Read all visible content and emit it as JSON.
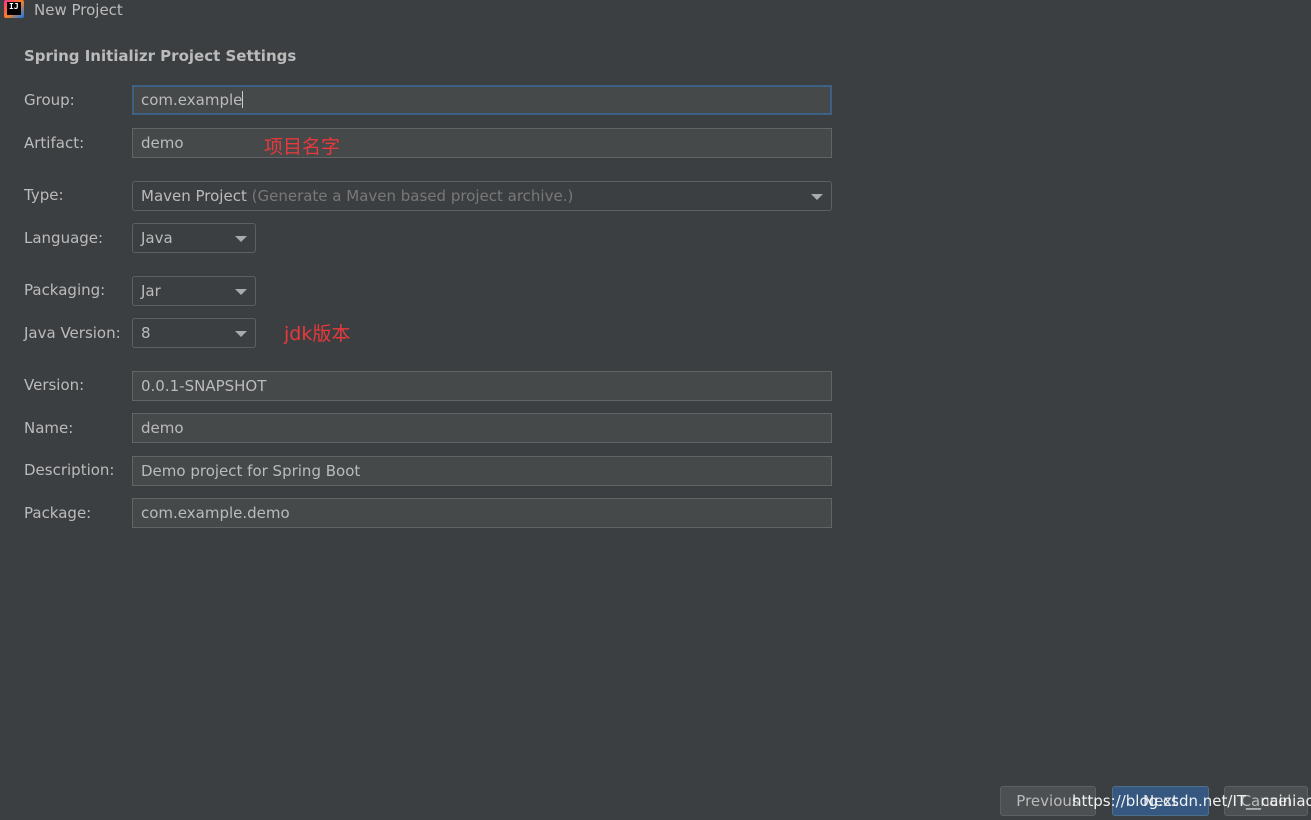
{
  "window": {
    "title": "New Project"
  },
  "section_title": "Spring Initializr Project Settings",
  "form": {
    "group": {
      "label": "Group:",
      "value": "com.example"
    },
    "artifact": {
      "label": "Artifact:",
      "value": "demo"
    },
    "type": {
      "label": "Type:",
      "value": "Maven Project",
      "hint": "(Generate a Maven based project archive.)"
    },
    "language": {
      "label": "Language:",
      "value": "Java"
    },
    "packaging": {
      "label": "Packaging:",
      "value": "Jar"
    },
    "java_version": {
      "label": "Java Version:",
      "value": "8"
    },
    "version": {
      "label": "Version:",
      "value": "0.0.1-SNAPSHOT"
    },
    "name": {
      "label": "Name:",
      "value": "demo"
    },
    "description": {
      "label": "Description:",
      "value": "Demo project for Spring Boot"
    },
    "package": {
      "label": "Package:",
      "value": "com.example.demo"
    }
  },
  "annotations": {
    "artifact_note": "项目名字",
    "jdk_note": "jdk版本"
  },
  "buttons": {
    "previous": "Previous",
    "next": "Next",
    "cancel": "Cancel"
  },
  "watermark": "https://blog.csdn.net/IT__cainiao",
  "colors": {
    "background": "#3c3f41",
    "annotation": "#e8393c",
    "focus_border": "#3d6185",
    "primary_button": "#365880"
  },
  "icons": [
    "intellij-app-icon",
    "chevron-down-icon"
  ]
}
